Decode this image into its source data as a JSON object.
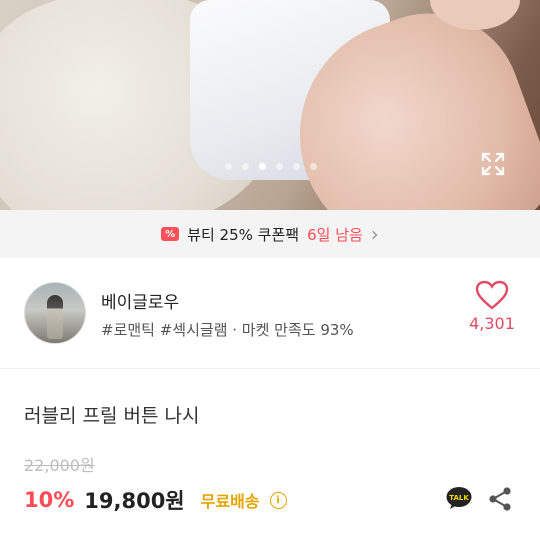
{
  "hero": {
    "dot_count": 6,
    "active_dot": 2
  },
  "coupon": {
    "badge": "%",
    "text": "뷰티 25% 쿠폰팩",
    "days_left": "6일 남음",
    "chevron": "›"
  },
  "seller": {
    "name": "베이글로우",
    "tags": "#로맨틱 #섹시글램 · 마켓 만족도 93%",
    "like_count": "4,301"
  },
  "product": {
    "title": "러블리 프릴 버튼 나시",
    "original_price": "22,000원",
    "discount": "10%",
    "price": "19,800원",
    "shipping": "무료배송",
    "info_glyph": "i"
  },
  "icons": {
    "expand": "expand-icon",
    "heart": "heart-icon",
    "talk": "kakaotalk-icon",
    "share": "share-icon"
  },
  "colors": {
    "accent": "#ff4b56",
    "like": "#e04c65",
    "shipping": "#e3a500"
  }
}
